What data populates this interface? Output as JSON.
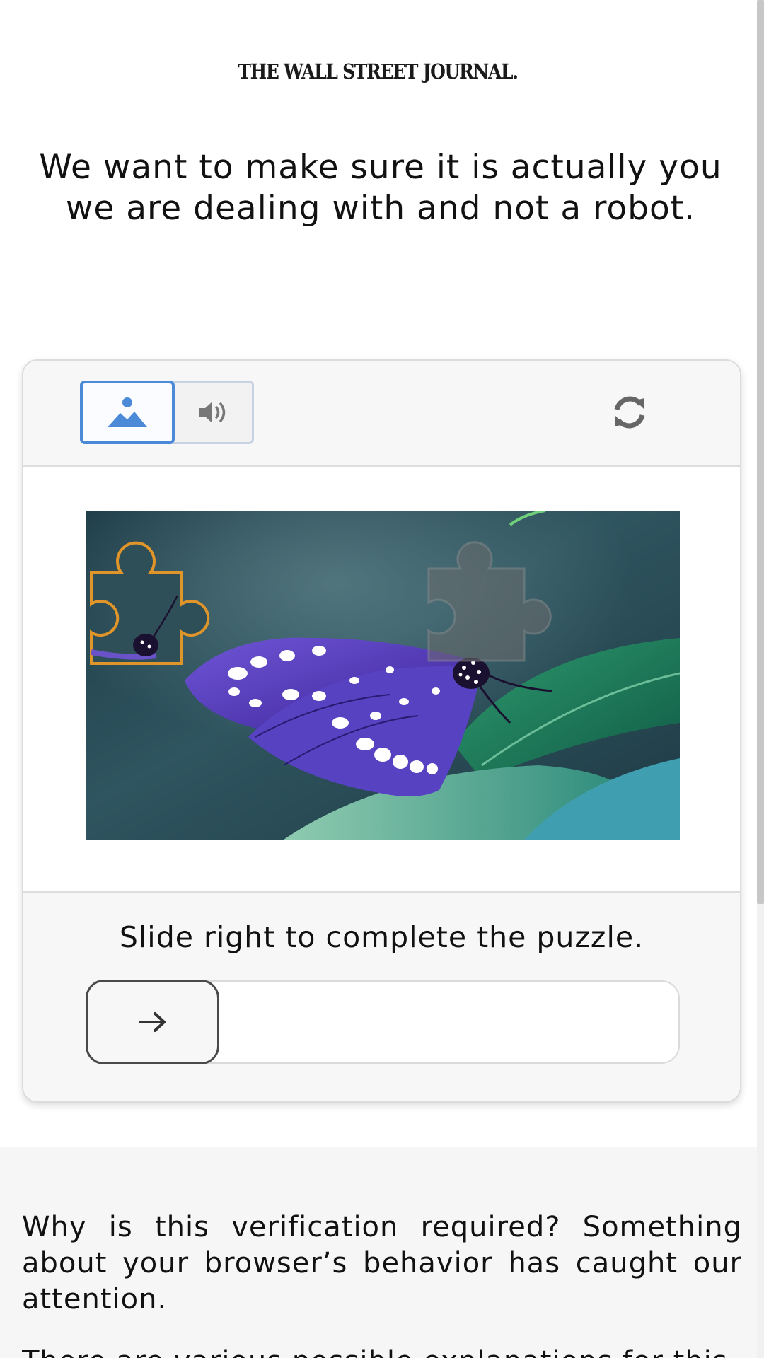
{
  "brand": {
    "logo_text": "THE WALL STREET JOURNAL."
  },
  "headline": "We want to make sure it is actually you we are dealing with and not a robot.",
  "captcha": {
    "modes": [
      {
        "icon": "image-mode-icon",
        "selected": true
      },
      {
        "icon": "audio-mode-icon",
        "selected": false
      }
    ],
    "refresh_icon": "refresh-icon",
    "instruction": "Slide right to complete the puzzle.",
    "slider_icon": "arrow-right-icon",
    "slider_progress": 0
  },
  "info": {
    "why_text": "Why is this verification required? Something about your browser’s behavior has caught our attention.",
    "next_text": "There are various possible explanations for this"
  },
  "colors": {
    "accent": "#4a8ad6",
    "puzzle_piece_outline": "#e0952a"
  }
}
